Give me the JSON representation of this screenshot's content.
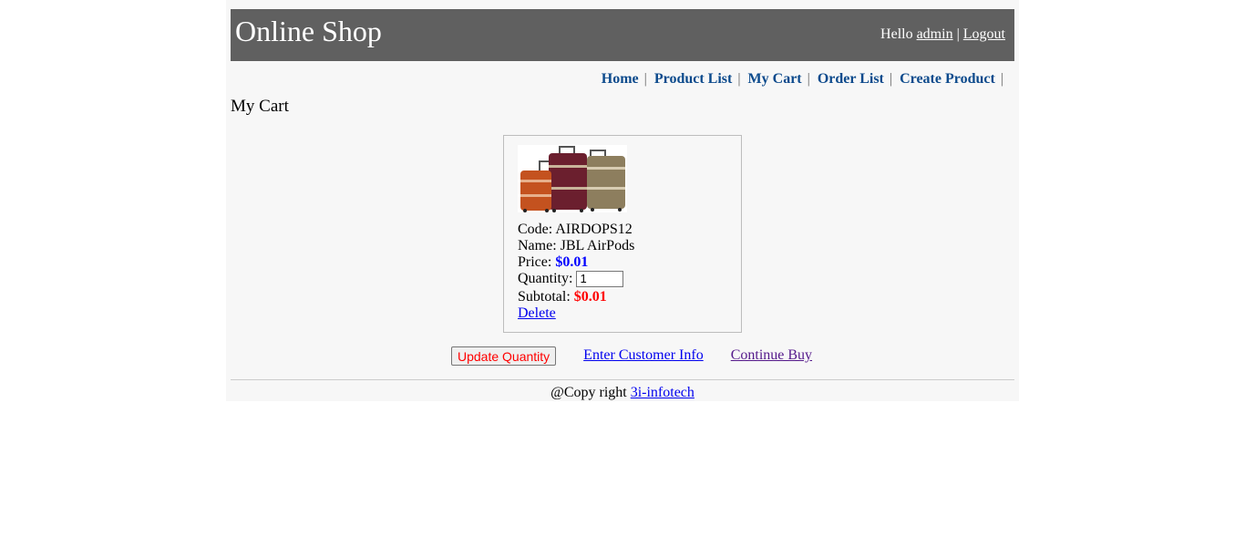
{
  "header": {
    "site_title": "Online Shop",
    "greeting": "Hello",
    "username": "admin",
    "separator": "|",
    "logout": "Logout"
  },
  "menu": {
    "items": [
      "Home",
      "Product List",
      "My Cart",
      "Order List",
      "Create Product"
    ],
    "separator": "|"
  },
  "page_title": "My Cart",
  "cart_item": {
    "code_label": "Code:",
    "code": "AIRDOPS12",
    "name_label": "Name:",
    "name": "JBL AirPods",
    "price_label": "Price:",
    "price": "$0.01",
    "quantity_label": "Quantity:",
    "quantity": "1",
    "subtotal_label": "Subtotal:",
    "subtotal": "$0.01",
    "delete": "Delete",
    "image": "luggage-set-image"
  },
  "actions": {
    "update": "Update Quantity",
    "enter_customer_info": "Enter Customer Info",
    "continue_buy": "Continue Buy"
  },
  "footer": {
    "copyright": "@Copy right",
    "company": "3i-infotech"
  },
  "colors": {
    "header_bg": "#606060",
    "menu_link": "#0c4a8c",
    "price": "#0000ff",
    "subtotal": "#ff0000",
    "page_bg": "#f7f7f7"
  }
}
